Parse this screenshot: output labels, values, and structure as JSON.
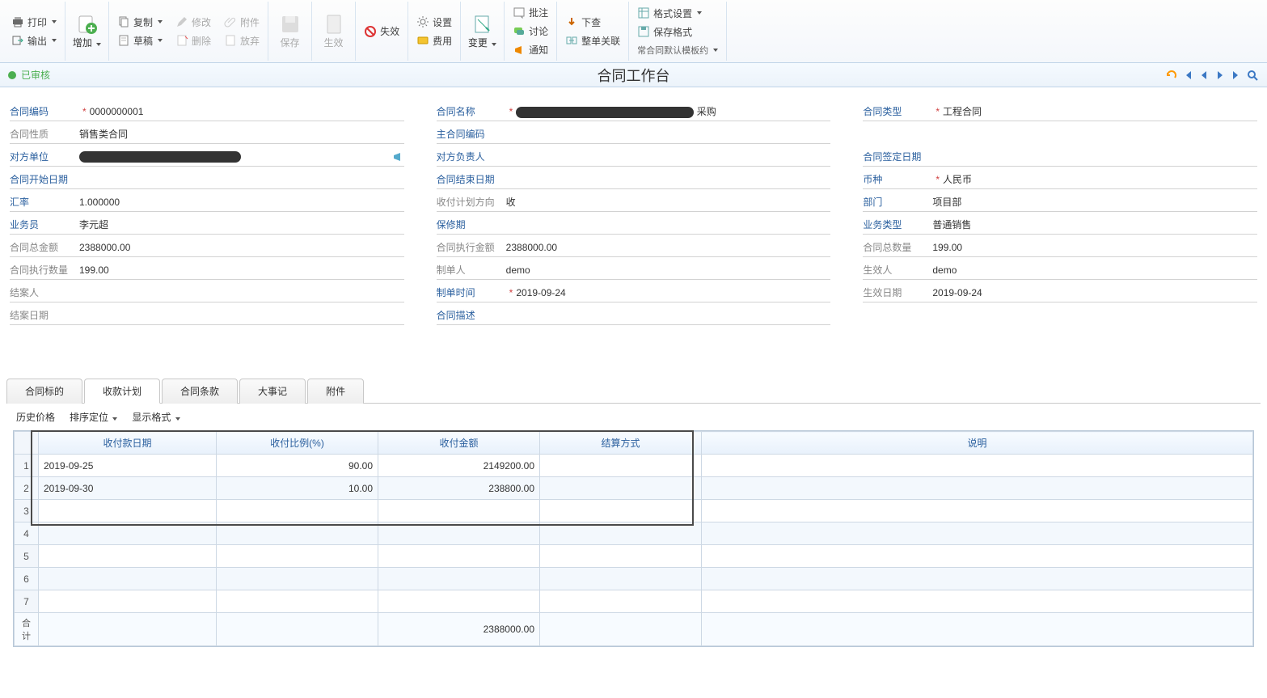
{
  "toolbar": {
    "print": "打印",
    "output": "输出",
    "add": "增加",
    "copy": "复制",
    "modify": "修改",
    "attachment": "附件",
    "draft": "草稿",
    "delete": "删除",
    "abandon": "放弃",
    "save": "保存",
    "effective": "生效",
    "invalid": "失效",
    "settings": "设置",
    "fee": "费用",
    "change": "变更",
    "annotation": "批注",
    "discuss": "讨论",
    "notify": "通知",
    "down_check": "下查",
    "whole_relation": "整单关联",
    "format_setting": "格式设置",
    "save_format": "保存格式",
    "template": "常合同默认模板约"
  },
  "status": {
    "text": "已审核"
  },
  "title": "合同工作台",
  "form": {
    "c1": {
      "contract_code_lbl": "合同编码",
      "contract_code": "0000000001",
      "contract_nature_lbl": "合同性质",
      "contract_nature": "销售类合同",
      "counterparty_lbl": "对方单位",
      "counterparty": "（已隐藏）",
      "start_date_lbl": "合同开始日期",
      "start_date": "",
      "rate_lbl": "汇率",
      "rate": "1.000000",
      "salesman_lbl": "业务员",
      "salesman": "李元超",
      "total_amount_lbl": "合同总金额",
      "total_amount": "2388000.00",
      "exec_qty_lbl": "合同执行数量",
      "exec_qty": "199.00",
      "closer_lbl": "结案人",
      "closer": "",
      "close_date_lbl": "结案日期",
      "close_date": ""
    },
    "c2": {
      "contract_name_lbl": "合同名称",
      "contract_name": "采购",
      "main_code_lbl": "主合同编码",
      "main_code": "",
      "counter_person_lbl": "对方负责人",
      "counter_person": "",
      "end_date_lbl": "合同结束日期",
      "end_date": "",
      "plan_dir_lbl": "收付计划方向",
      "plan_dir": "收",
      "warranty_lbl": "保修期",
      "warranty": "",
      "exec_amount_lbl": "合同执行金额",
      "exec_amount": "2388000.00",
      "maker_lbl": "制单人",
      "maker": "demo",
      "make_time_lbl": "制单时间",
      "make_time": "2019-09-24",
      "desc_lbl": "合同描述",
      "desc": ""
    },
    "c3": {
      "contract_type_lbl": "合同类型",
      "contract_type": "工程合同",
      "sign_date_lbl": "合同签定日期",
      "sign_date": "",
      "currency_lbl": "币种",
      "currency": "人民币",
      "dept_lbl": "部门",
      "dept": "项目部",
      "biz_type_lbl": "业务类型",
      "biz_type": "普通销售",
      "total_qty_lbl": "合同总数量",
      "total_qty": "199.00",
      "effector_lbl": "生效人",
      "effector": "demo",
      "effect_date_lbl": "生效日期",
      "effect_date": "2019-09-24"
    }
  },
  "tabs": {
    "t1": "合同标的",
    "t2": "收款计划",
    "t3": "合同条款",
    "t4": "大事记",
    "t5": "附件"
  },
  "grid_toolbar": {
    "history_price": "历史价格",
    "sort_locate": "排序定位",
    "display_format": "显示格式"
  },
  "grid": {
    "headers": {
      "date": "收付款日期",
      "ratio": "收付比例(%)",
      "amount": "收付金额",
      "settle": "结算方式",
      "remark": "说明"
    },
    "rows": [
      {
        "n": "1",
        "date": "2019-09-25",
        "ratio": "90.00",
        "amount": "2149200.00",
        "settle": "",
        "remark": ""
      },
      {
        "n": "2",
        "date": "2019-09-30",
        "ratio": "10.00",
        "amount": "238800.00",
        "settle": "",
        "remark": ""
      },
      {
        "n": "3",
        "date": "",
        "ratio": "",
        "amount": "",
        "settle": "",
        "remark": ""
      },
      {
        "n": "4",
        "date": "",
        "ratio": "",
        "amount": "",
        "settle": "",
        "remark": ""
      },
      {
        "n": "5",
        "date": "",
        "ratio": "",
        "amount": "",
        "settle": "",
        "remark": ""
      },
      {
        "n": "6",
        "date": "",
        "ratio": "",
        "amount": "",
        "settle": "",
        "remark": ""
      },
      {
        "n": "7",
        "date": "",
        "ratio": "",
        "amount": "",
        "settle": "",
        "remark": ""
      }
    ],
    "sum_label": "合计",
    "sum_amount": "2388000.00"
  }
}
